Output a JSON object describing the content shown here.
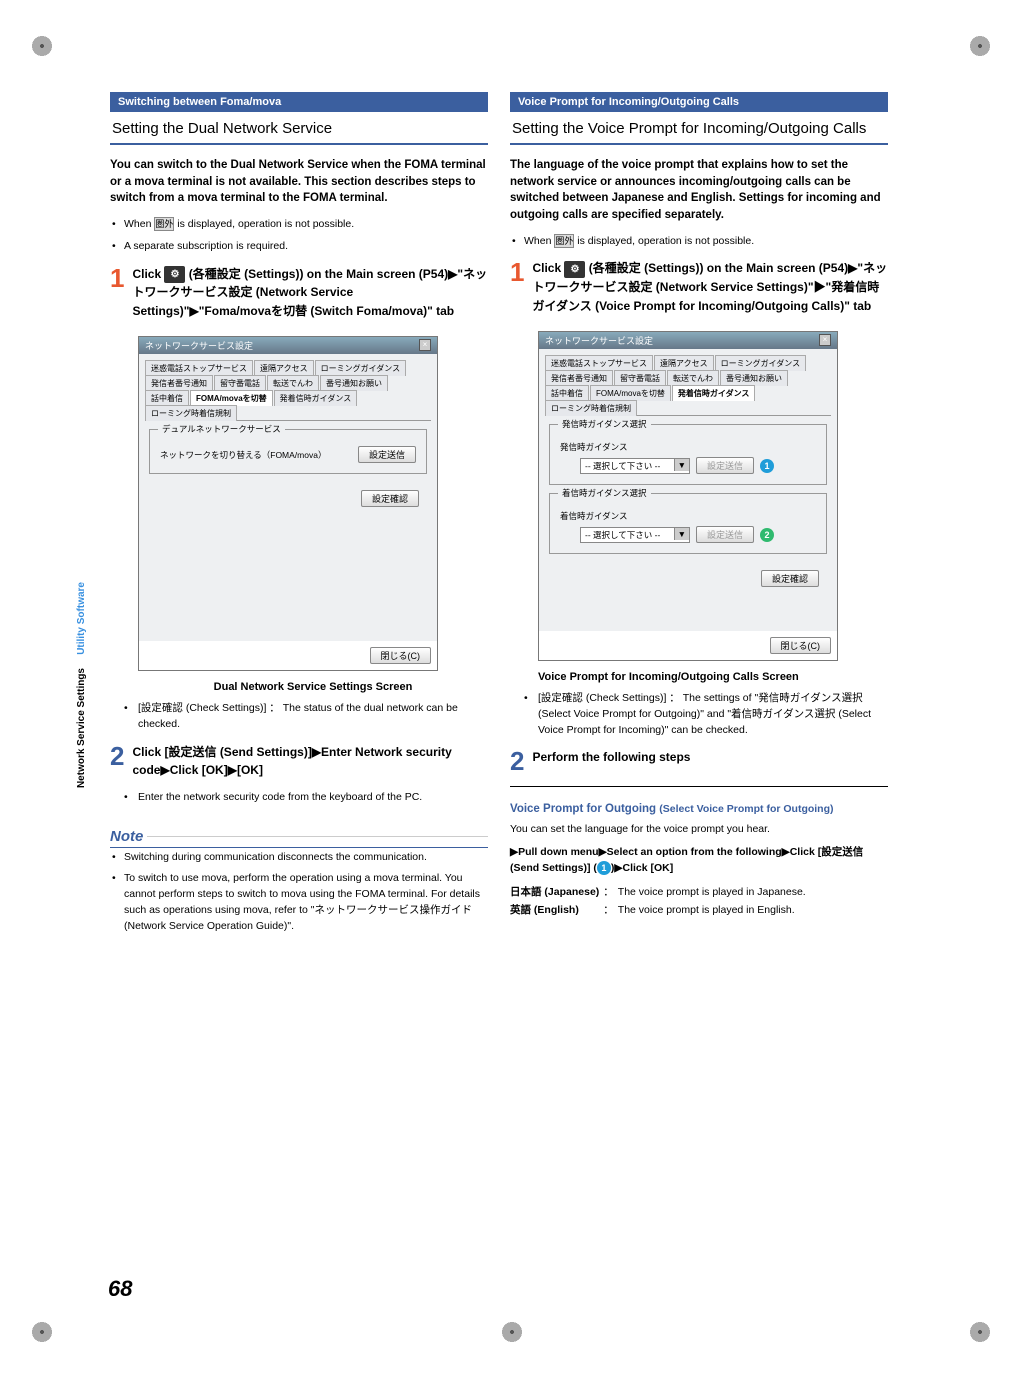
{
  "page_number": "68",
  "sidebar": {
    "blue": "Utility Software",
    "black": "Network Service Settings"
  },
  "left": {
    "header_blue": "Switching between Foma/mova",
    "title": "Setting the Dual Network Service",
    "intro": "You can switch to the Dual Network Service when the FOMA terminal or a mova terminal is not available. This section describes steps to switch from a mova terminal to the FOMA terminal.",
    "b1_a": "When ",
    "b1_b": " is displayed, operation is not possible.",
    "b2": "A separate subscription is required.",
    "step1_a": "Click ",
    "step1_b": " (各種設定 (Settings)) on the Main screen (P54)▶\"ネットワークサービス設定 (Network Service Settings)\"▶\"Foma/movaを切替 (Switch Foma/mova)\" tab",
    "shot_title": "ネットワークサービス設定",
    "tabs": [
      "迷惑電話ストップサービス",
      "遠隔アクセス",
      "ローミングガイダンス",
      "発信者番号通知",
      "留守番電話",
      "転送でんわ",
      "番号通知お願い",
      "話中着信",
      "FOMA/movaを切替",
      "発着信時ガイダンス",
      "ローミング時着信規制"
    ],
    "fieldset_legend": "デュアルネットワークサービス",
    "switch_label": "ネットワークを切り替える（FOMA/mova）",
    "btn_send": "設定送信",
    "btn_confirm": "設定確認",
    "btn_close": "閉じる(C)",
    "caption": "Dual Network Service Settings Screen",
    "sub1": "[設定確認 (Check Settings)] ： The status of the dual network can be checked.",
    "step2": "Click [設定送信 (Send Settings)]▶Enter Network security code▶Click [OK]▶[OK]",
    "sub2": "Enter the network security code from the keyboard of the PC.",
    "note_title": "Note",
    "note1": "Switching during communication disconnects the communication.",
    "note2": "To switch to use mova, perform the operation using a mova terminal. You cannot perform steps to switch to mova using the FOMA terminal. For details such as operations using mova, refer to \"ネットワークサービス操作ガイド (Network Service Operation Guide)\"."
  },
  "right": {
    "header_blue": "Voice Prompt for Incoming/Outgoing Calls",
    "title": "Setting the Voice Prompt for Incoming/Outgoing Calls",
    "intro": "The language of the voice prompt that explains how to set the network service or announces incoming/outgoing calls can be switched between Japanese and English. Settings for incoming and outgoing calls are specified separately.",
    "b1_a": "When ",
    "b1_b": " is displayed, operation is not possible.",
    "step1_a": "Click ",
    "step1_b": " (各種設定 (Settings)) on the Main screen (P54)▶\"ネットワークサービス設定 (Network Service Settings)\"▶\"発着信時ガイダンス (Voice Prompt for Incoming/Outgoing Calls)\" tab",
    "shot_title": "ネットワークサービス設定",
    "fs1_legend": "発信時ガイダンス選択",
    "fs1_label": "発信時ガイダンス",
    "fs2_legend": "着信時ガイダンス選択",
    "fs2_label": "着信時ガイダンス",
    "select_placeholder": "-- 選択して下さい --",
    "btn_send": "設定送信",
    "btn_confirm": "設定確認",
    "btn_close": "閉じる(C)",
    "caption": "Voice Prompt for Incoming/Outgoing Calls Screen",
    "sub1": "[設定確認 (Check Settings)] ： The settings of \"発信時ガイダンス選択 (Select Voice Prompt for Outgoing)\" and \"着信時ガイダンス選択 (Select Voice Prompt for Incoming)\" can be checked.",
    "step2": "Perform the following steps",
    "sub_head_1a": "Voice Prompt for Outgoing ",
    "sub_head_1b": "(Select Voice Prompt for Outgoing)",
    "sub_desc": "You can set the language for the voice prompt you hear.",
    "inst_a": "▶Pull down menu▶Select an option from the following▶Click [設定送信 (Send Settings)] (",
    "inst_b": ")▶Click [OK]",
    "row1_label": "日本語 (Japanese)",
    "row1_sep": "：",
    "row1_desc": "The voice prompt is played in Japanese.",
    "row2_label": "英語 (English)",
    "row2_sep": "：",
    "row2_desc": "The voice prompt is played in English."
  }
}
